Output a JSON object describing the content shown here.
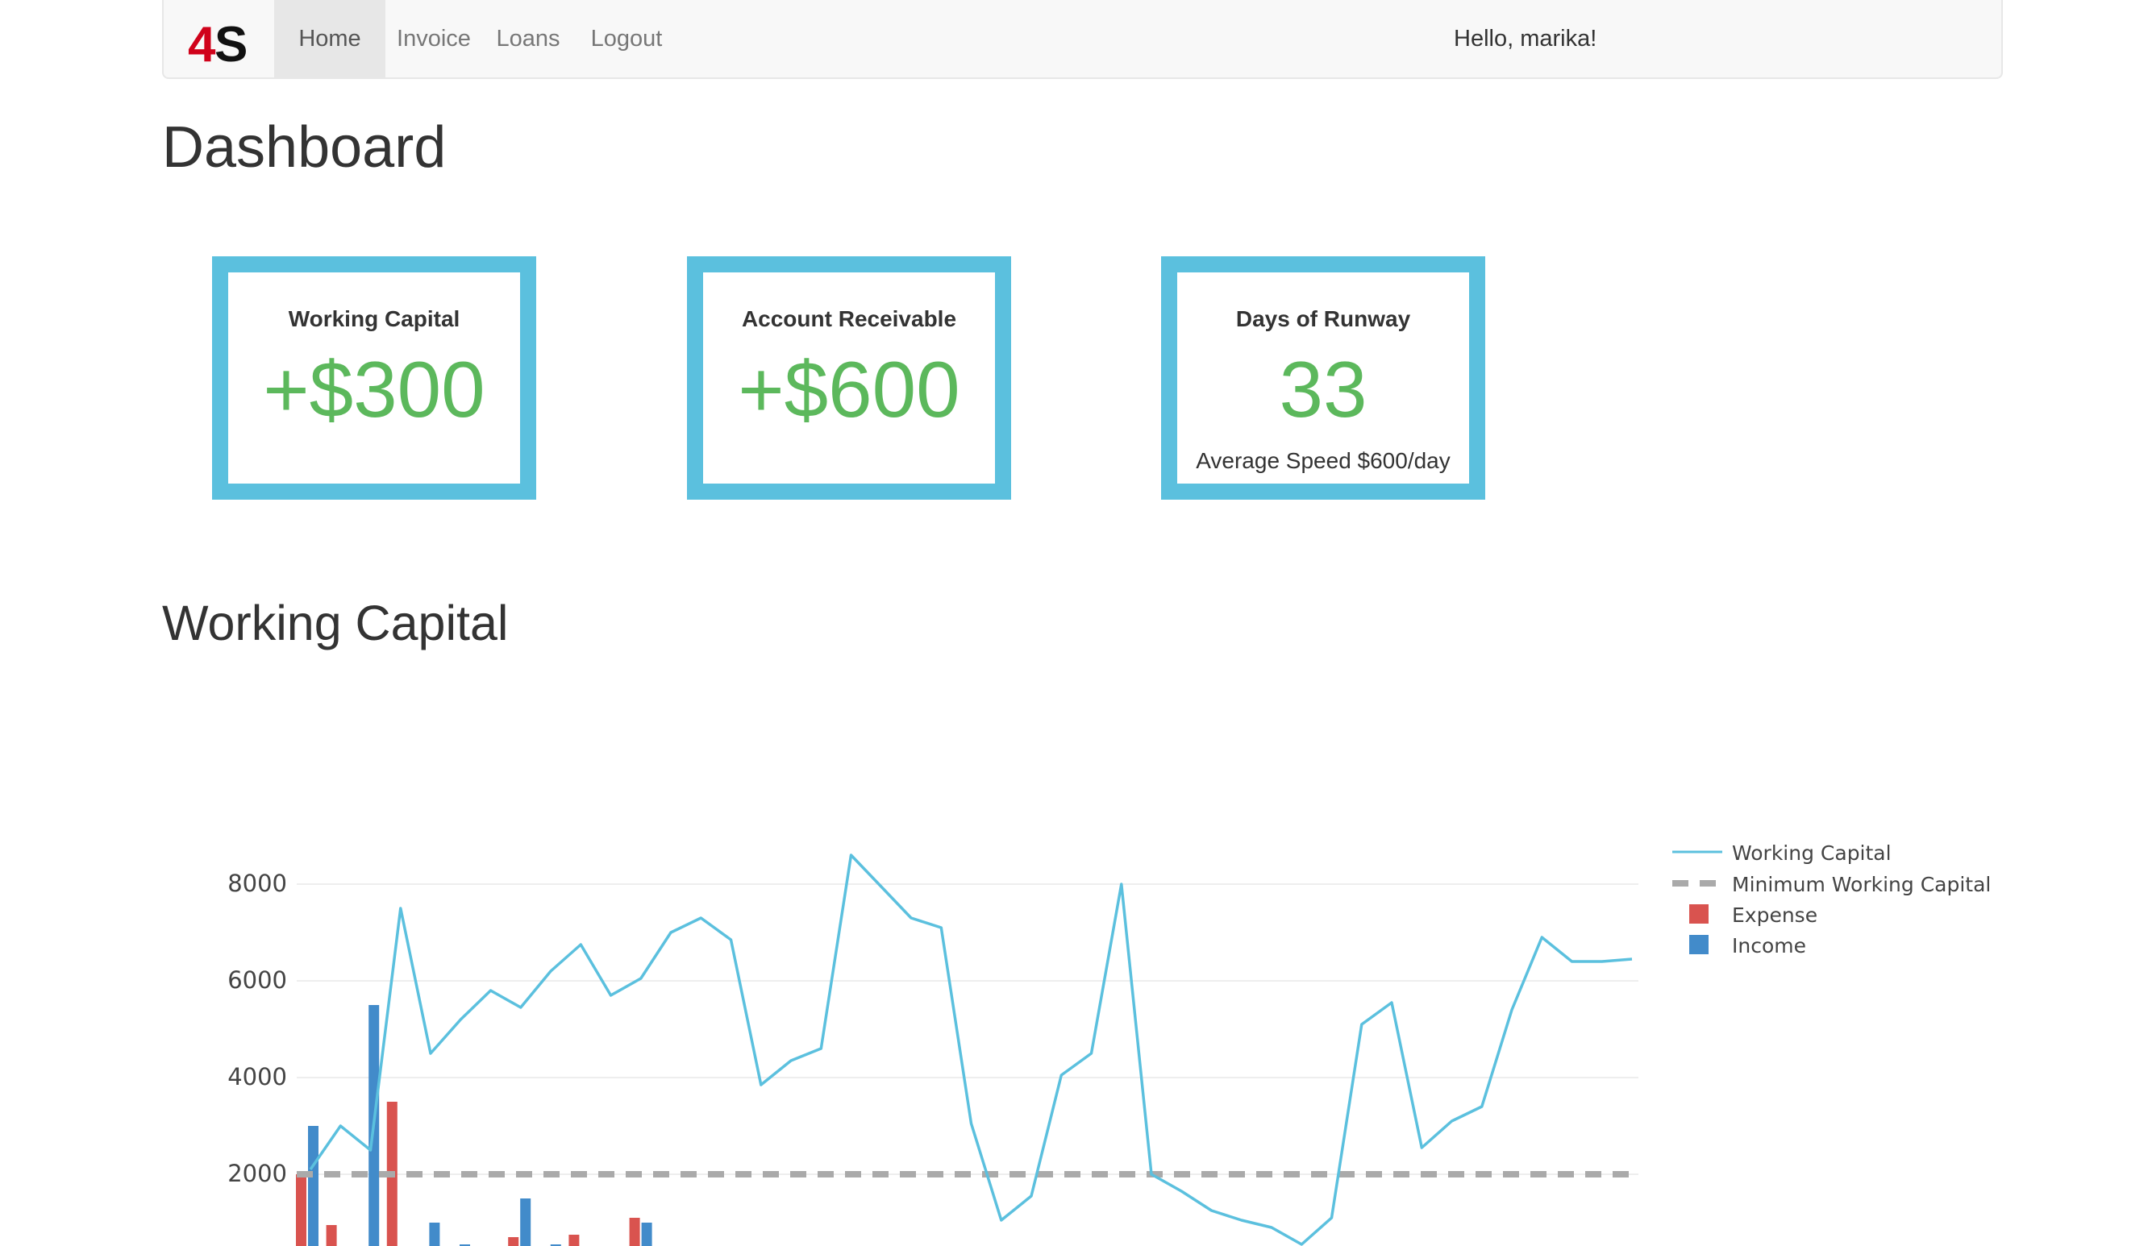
{
  "navbar": {
    "brand": "4S",
    "items": [
      {
        "label": "Home",
        "active": true
      },
      {
        "label": "Invoice",
        "active": false
      },
      {
        "label": "Loans",
        "active": false
      },
      {
        "label": "Logout",
        "active": false
      }
    ],
    "greeting": "Hello, marika!"
  },
  "page_title": "Dashboard",
  "cards": [
    {
      "label": "Working Capital",
      "value": "+$300",
      "sub": ""
    },
    {
      "label": "Account Receivable",
      "value": "+$600",
      "sub": ""
    },
    {
      "label": "Days of Runway",
      "value": "33",
      "sub": "Average Speed $600/day"
    }
  ],
  "section_title": "Working Capital",
  "colors": {
    "accent_border": "#5bc0de",
    "positive_value": "#5cb85c",
    "working_capital_line": "#5bc0de",
    "minimum_line": "#aaaaaa",
    "expense": "#d9534f",
    "income": "#428bca"
  },
  "chart_data": {
    "type": "line",
    "y_ticks": [
      "8000",
      "6000",
      "4000",
      "2000"
    ],
    "legend_position": "top-right",
    "series": [
      {
        "name": "Working Capital",
        "type": "line",
        "values": [
          2100,
          3000,
          2500,
          7500,
          4500,
          5200,
          5800,
          5450,
          6200,
          6750,
          5700,
          6050,
          7000,
          7300,
          6850,
          3850,
          4350,
          4600,
          8600,
          7950,
          7300,
          7100,
          3050,
          1050,
          1550,
          4050,
          4500,
          8000,
          2000,
          1650,
          1250,
          1050,
          900,
          550,
          1100,
          5100,
          5550,
          2550,
          3100,
          3400,
          5400,
          6900,
          6400,
          6400,
          6450
        ]
      },
      {
        "name": "Minimum Working Capital",
        "type": "line-dashed",
        "values": [
          2000
        ]
      },
      {
        "name": "Expense",
        "type": "bar",
        "values": [
          2000,
          950,
          450,
          3500,
          0,
          0,
          50,
          700,
          0,
          750,
          0,
          1100,
          0
        ]
      },
      {
        "name": "Income",
        "type": "bar",
        "values": [
          3000,
          450,
          5500,
          450,
          1000,
          550,
          0,
          1500,
          550,
          0,
          450,
          1000,
          450
        ]
      }
    ]
  }
}
